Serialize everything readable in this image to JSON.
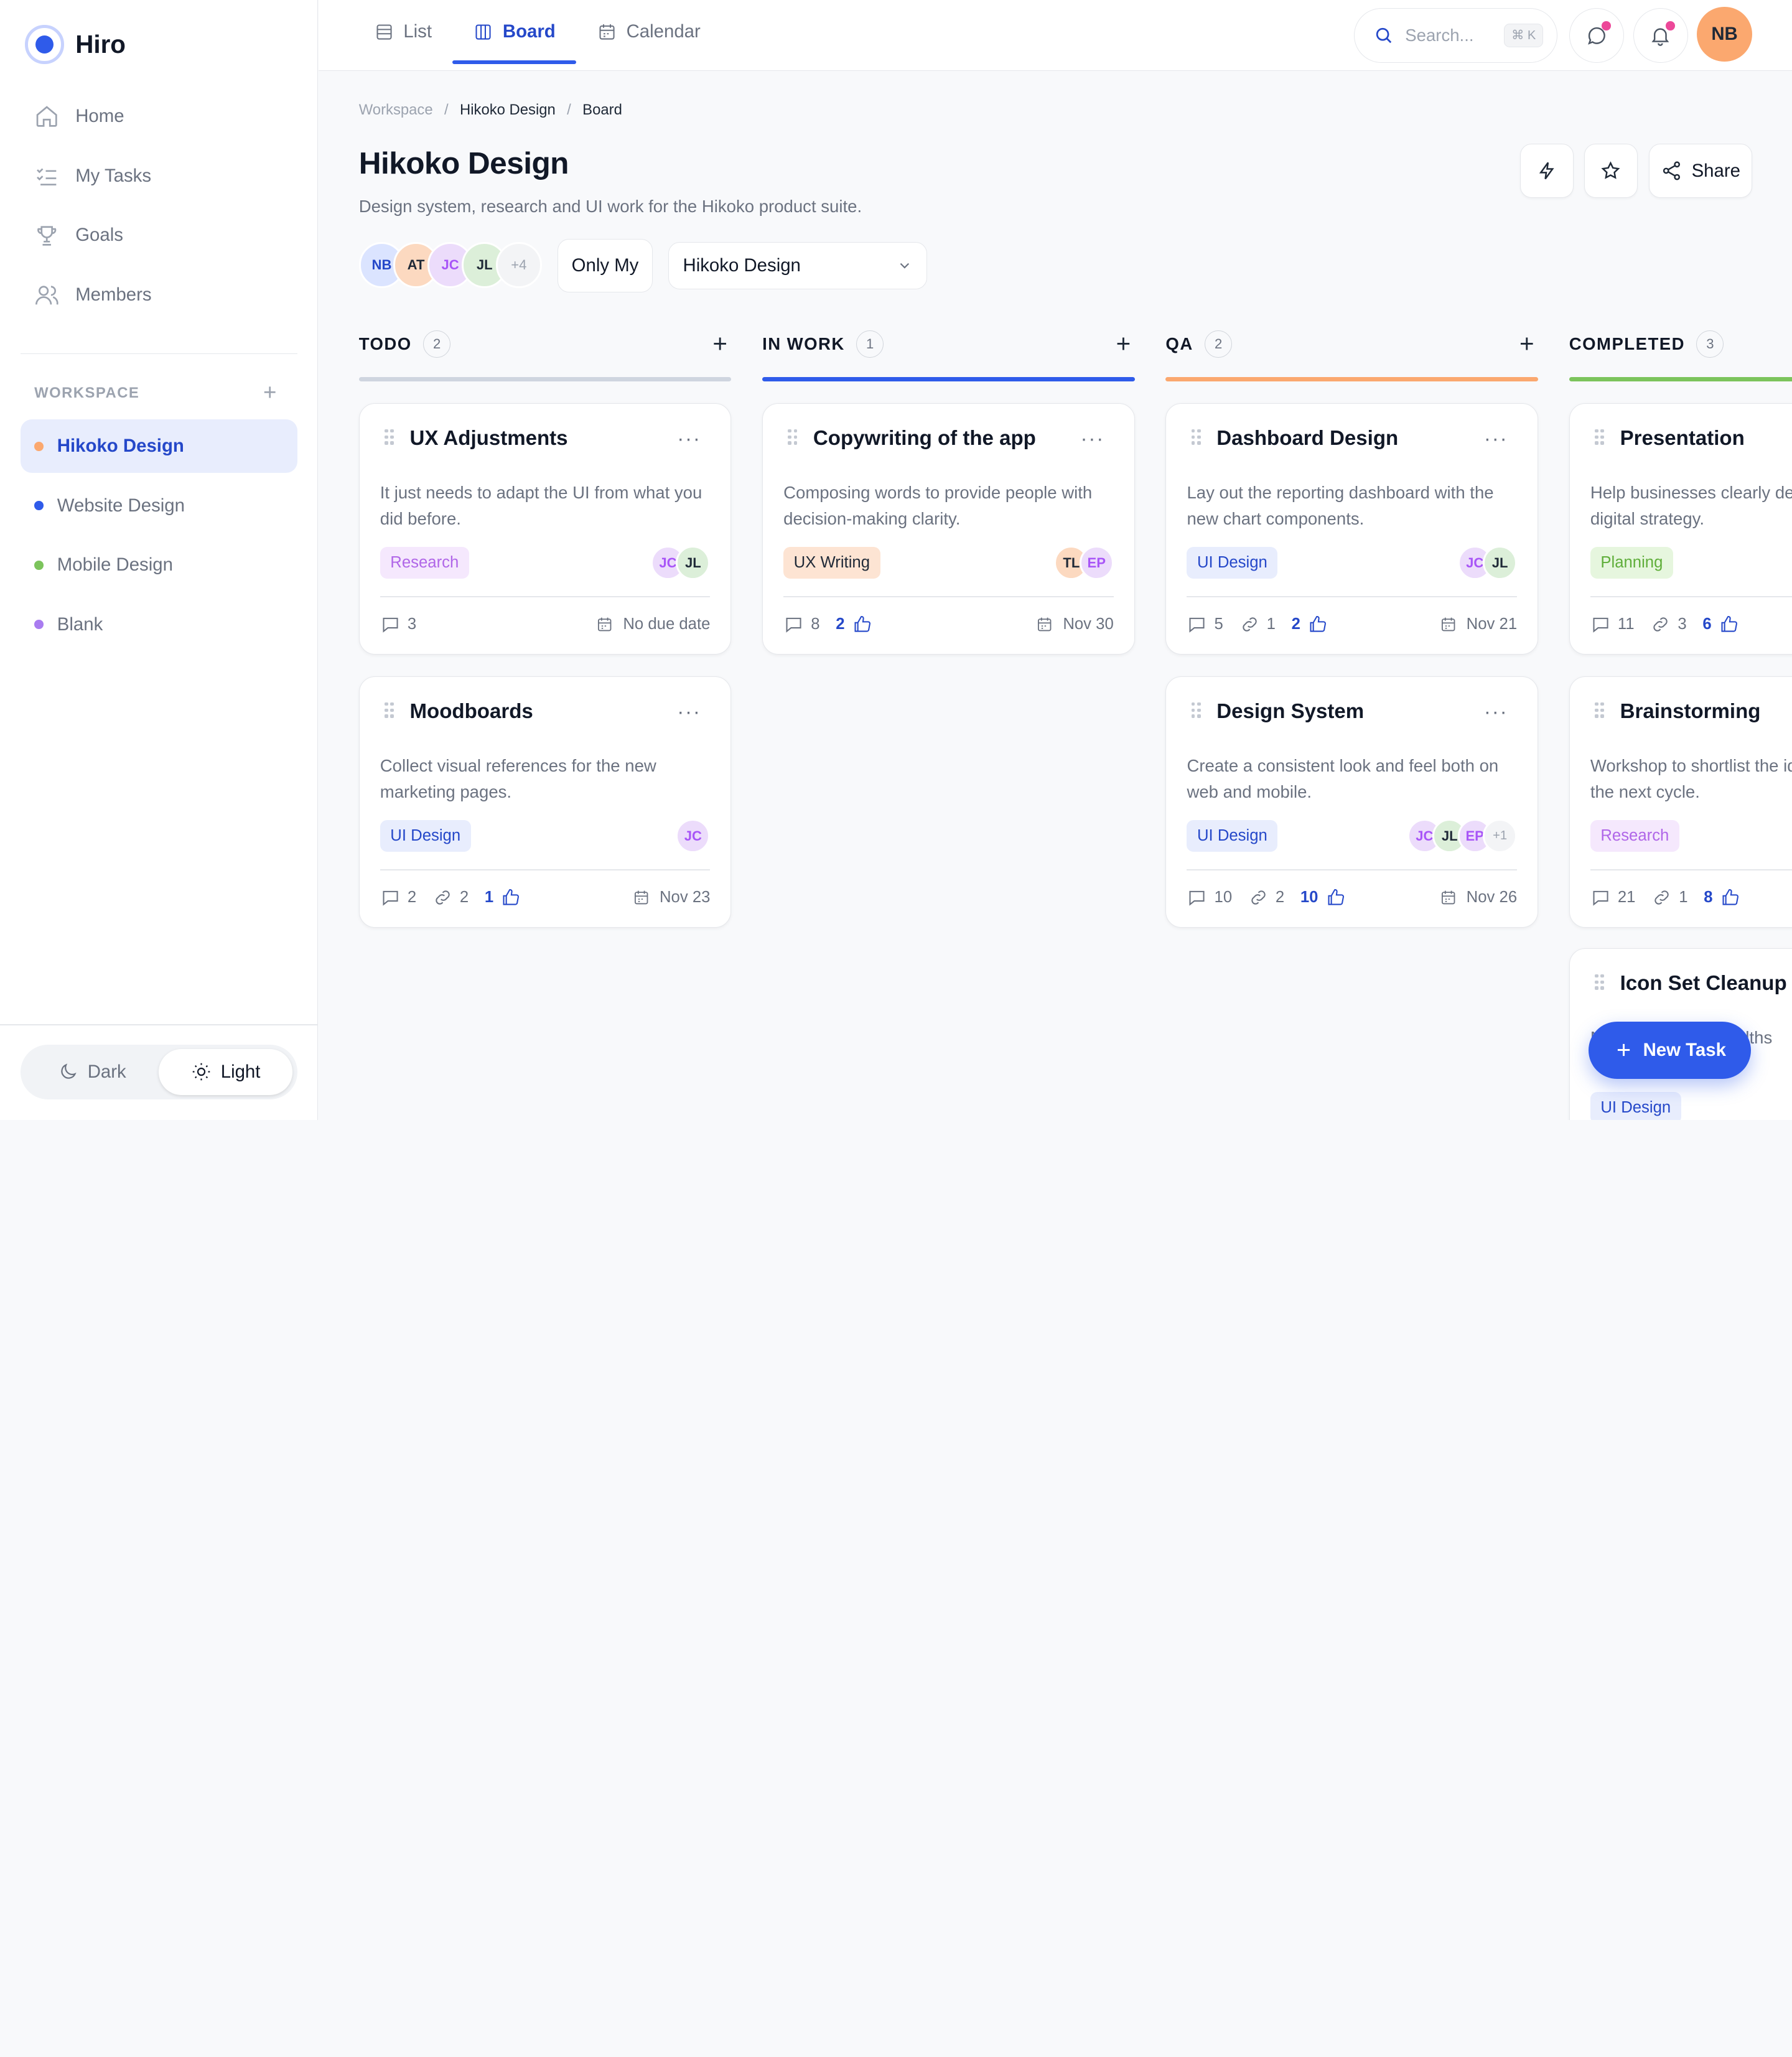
{
  "brand": {
    "name": "Hiro",
    "accent": "#2f5bea"
  },
  "nav": [
    {
      "label": "Home",
      "icon": "home-icon"
    },
    {
      "label": "My Tasks",
      "icon": "tasks-icon"
    },
    {
      "label": "Goals",
      "icon": "trophy-icon"
    },
    {
      "label": "Members",
      "icon": "users-icon"
    }
  ],
  "workspace": {
    "title": "WORKSPACE",
    "add_label": "+",
    "items": [
      {
        "label": "Hikoko Design",
        "color": "#fba86f",
        "active": true
      },
      {
        "label": "Website Design",
        "color": "#2f5bea",
        "active": false
      },
      {
        "label": "Mobile Design",
        "color": "#7cc45c",
        "active": false
      },
      {
        "label": "Blank",
        "color": "#a97cf0",
        "active": false
      }
    ]
  },
  "theme": {
    "dark_label": "Dark",
    "light_label": "Light",
    "selected": "Light"
  },
  "topbar": {
    "tabs": [
      {
        "label": "List",
        "active": false
      },
      {
        "label": "Board",
        "active": true
      },
      {
        "label": "Calendar",
        "active": false
      }
    ],
    "search_placeholder": "Search...",
    "search_shortcut": "⌘ K",
    "user_initials": "NB"
  },
  "breadcrumb": {
    "root": "Workspace",
    "project": "Hikoko Design",
    "current": "Board",
    "sep": "/"
  },
  "page": {
    "title": "Hikoko Design",
    "description": "Design system, research and UI work for the Hikoko product suite.",
    "share_label": "Share",
    "filter_label": "Only My",
    "project_select": "Hikoko Design",
    "members": [
      {
        "initials": "NB",
        "bg": "#dbe4ff",
        "fg": "#2548c9"
      },
      {
        "initials": "AT",
        "bg": "#fcd9c0",
        "fg": "#1f2937"
      },
      {
        "initials": "JC",
        "bg": "#ecdcfb",
        "fg": "#a855f7"
      },
      {
        "initials": "JL",
        "bg": "#dcefd9",
        "fg": "#1f2937"
      }
    ],
    "members_more": "+4"
  },
  "tag_styles": {
    "Research": {
      "bg": "#f5e8fd",
      "fg": "#b066e8"
    },
    "UX Writing": {
      "bg": "#fde4d3",
      "fg": "#1f2937"
    },
    "UI Design": {
      "bg": "#e8edfd",
      "fg": "#2548c9"
    },
    "Planning": {
      "bg": "#e6f6de",
      "fg": "#5fae3a"
    }
  },
  "columns": [
    {
      "title": "TODO",
      "count": "2",
      "color": "#cfd5df",
      "cards": [
        {
          "title": "UX Adjustments",
          "description": "It just needs to adapt the UI from what you did before.",
          "tag": "Research",
          "assignees": [
            {
              "initials": "JC",
              "bg": "#ecdcfb",
              "fg": "#a855f7"
            },
            {
              "initials": "JL",
              "bg": "#dcefd9",
              "fg": "#1f2937"
            }
          ],
          "comments": "3",
          "due": "No due date"
        },
        {
          "title": "Moodboards",
          "description": "Collect visual references for the new marketing pages.",
          "tag": "UI Design",
          "assignees": [
            {
              "initials": "JC",
              "bg": "#ecdcfb",
              "fg": "#a855f7"
            }
          ],
          "comments": "2",
          "links": "2",
          "likes": "1",
          "due": "Nov 23"
        }
      ]
    },
    {
      "title": "IN WORK",
      "count": "1",
      "color": "#2f5bea",
      "cards": [
        {
          "title": "Copywriting of the app",
          "description": "Composing words to provide people with decision-making clarity.",
          "tag": "UX Writing",
          "assignees": [
            {
              "initials": "TL",
              "bg": "#fcd9c0",
              "fg": "#1f2937"
            },
            {
              "initials": "EP",
              "bg": "#ecdcfb",
              "fg": "#a855f7"
            }
          ],
          "comments": "8",
          "likes": "2",
          "due": "Nov 30"
        }
      ]
    },
    {
      "title": "QA",
      "count": "2",
      "color": "#fba86f",
      "cards": [
        {
          "title": "Dashboard Design",
          "description": "Lay out the reporting dashboard with the new chart components.",
          "tag": "UI Design",
          "assignees": [
            {
              "initials": "JC",
              "bg": "#ecdcfb",
              "fg": "#a855f7"
            },
            {
              "initials": "JL",
              "bg": "#dcefd9",
              "fg": "#1f2937"
            }
          ],
          "comments": "5",
          "links": "1",
          "likes": "2",
          "due": "Nov 21"
        },
        {
          "title": "Design System",
          "description": "Create a consistent look and feel both on web and mobile.",
          "tag": "UI Design",
          "assignees": [
            {
              "initials": "JC",
              "bg": "#ecdcfb",
              "fg": "#a855f7"
            },
            {
              "initials": "JL",
              "bg": "#dcefd9",
              "fg": "#1f2937"
            },
            {
              "initials": "EP",
              "bg": "#ecdcfb",
              "fg": "#a855f7"
            }
          ],
          "assignees_more": "+1",
          "comments": "10",
          "links": "2",
          "likes": "10",
          "due": "Nov 26"
        }
      ]
    },
    {
      "title": "COMPLETED",
      "count": "3",
      "color": "#7cc45c",
      "cards": [
        {
          "title": "Presentation",
          "description": "Help businesses clearly define their annual digital strategy.",
          "tag": "Planning",
          "assignees": [],
          "comments": "11",
          "links": "3",
          "likes": "6",
          "due": ""
        },
        {
          "title": "Brainstorming",
          "description": "Workshop to shortlist the ideas that go into the next cycle.",
          "tag": "Research",
          "assignees": [],
          "comments": "21",
          "links": "1",
          "likes": "8",
          "due": ""
        },
        {
          "title": "Icon Set Cleanup",
          "description": "Normalize stroke widths",
          "tag": "UI Design",
          "assignees": [],
          "comments": "",
          "due": ""
        }
      ]
    }
  ],
  "fab": {
    "label": "New Task"
  }
}
